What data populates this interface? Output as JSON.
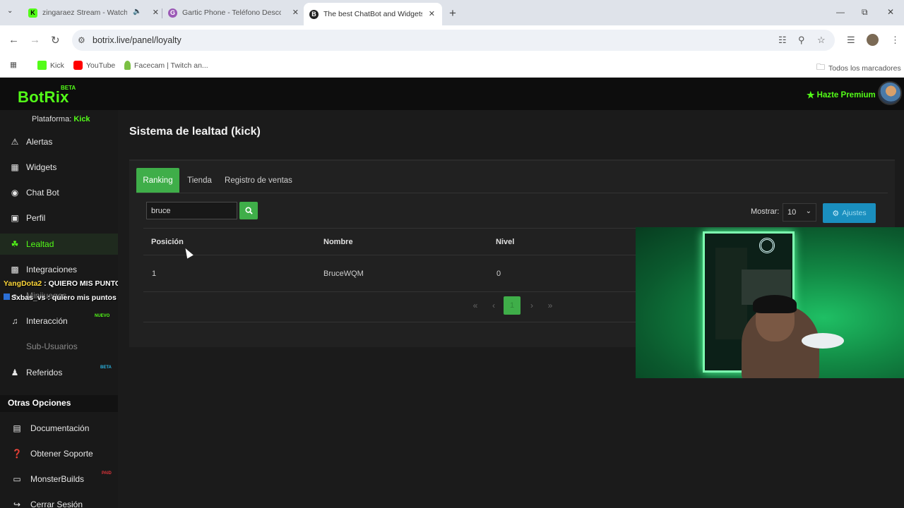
{
  "browser": {
    "tabs": [
      {
        "title": "zingaraez Stream - Watch L",
        "favicon": "K"
      },
      {
        "title": "Gartic Phone - Teléfono Descor",
        "favicon": "G"
      },
      {
        "title": "The best ChatBot and Widgets f",
        "favicon": "B"
      }
    ],
    "url": "botrix.live/panel/loyalty",
    "bookmarks": [
      "Kick",
      "YouTube",
      "Facecam | Twitch an..."
    ],
    "all_bookmarks": "Todos los marcadores"
  },
  "app": {
    "logo": "BotRix",
    "logo_badge": "BETA",
    "premium": "Hazte Premium",
    "platform_label": "Plataforma:",
    "platform_value": "Kick"
  },
  "sidebar": {
    "items": [
      {
        "label": "Alertas",
        "icon": "warning-icon"
      },
      {
        "label": "Widgets",
        "icon": "grid-icon"
      },
      {
        "label": "Chat Bot",
        "icon": "robot-icon"
      },
      {
        "label": "Perfil",
        "icon": "id-card-icon"
      },
      {
        "label": "Lealtad",
        "icon": "trophy-icon"
      },
      {
        "label": "Integraciones",
        "icon": "puzzle-icon"
      },
      {
        "label": "Minijuegos",
        "icon": "gamepad-icon"
      },
      {
        "label": "Interacción",
        "icon": "music-icon",
        "badge": "NUEVO"
      },
      {
        "label": "Sub-Usuarios",
        "icon": "users-icon"
      },
      {
        "label": "Referidos",
        "icon": "users-icon",
        "badge": "BETA"
      }
    ],
    "otras_title": "Otras Opciones",
    "otras": [
      {
        "label": "Documentación",
        "icon": "book-icon"
      },
      {
        "label": "Obtener Soporte",
        "icon": "question-icon"
      },
      {
        "label": "MonsterBuilds",
        "icon": "laptop-icon",
        "badge": "PAID"
      },
      {
        "label": "Cerrar Sesión",
        "icon": "logout-icon"
      }
    ]
  },
  "chat_overlay": [
    {
      "user": "YangDota2",
      "message": " : QUIERO MIS PUNTOS"
    },
    {
      "user": "Sxbas_vs",
      "message": " : quiero mis puntos"
    }
  ],
  "main": {
    "title": "Sistema de lealtad (kick)",
    "tabs": [
      "Ranking",
      "Tienda",
      "Registro de ventas"
    ],
    "search_value": "bruce",
    "show_label": "Mostrar:",
    "show_value": "10",
    "settings_label": "Ajustes",
    "columns": [
      "Posición",
      "Nombre",
      "Nivel"
    ],
    "rows": [
      {
        "position": "1",
        "name": "BruceWQM",
        "level": "0"
      }
    ],
    "pagination": {
      "current": "1",
      "first": "«",
      "prev": "‹",
      "next": "›",
      "last": "»"
    }
  },
  "colors": {
    "accent": "#53fc18",
    "green_button": "#3fae49",
    "info_button": "#1a8fbf"
  }
}
